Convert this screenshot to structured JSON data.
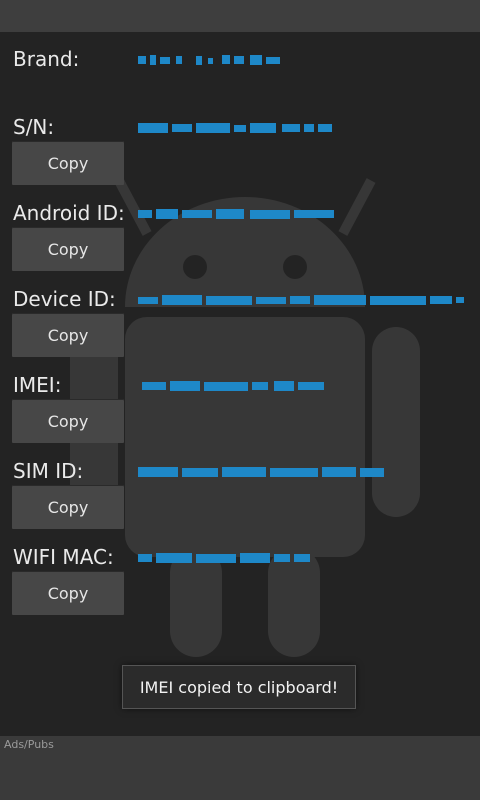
{
  "app": {
    "accent_color": "#1e88c8",
    "watermark_icon": "android-robot-icon"
  },
  "fields": {
    "brand_label": "Brand:",
    "sn_label": "S/N:",
    "android_id_label": "Android ID:",
    "device_id_label": "Device ID:",
    "imei_label": "IMEI:",
    "sim_id_label": "SIM ID:",
    "wifi_mac_label": "WIFI MAC:"
  },
  "buttons": {
    "copy_label": "Copy"
  },
  "toast": {
    "message": "IMEI copied to clipboard!"
  },
  "ads": {
    "label": "Ads/Pubs"
  }
}
